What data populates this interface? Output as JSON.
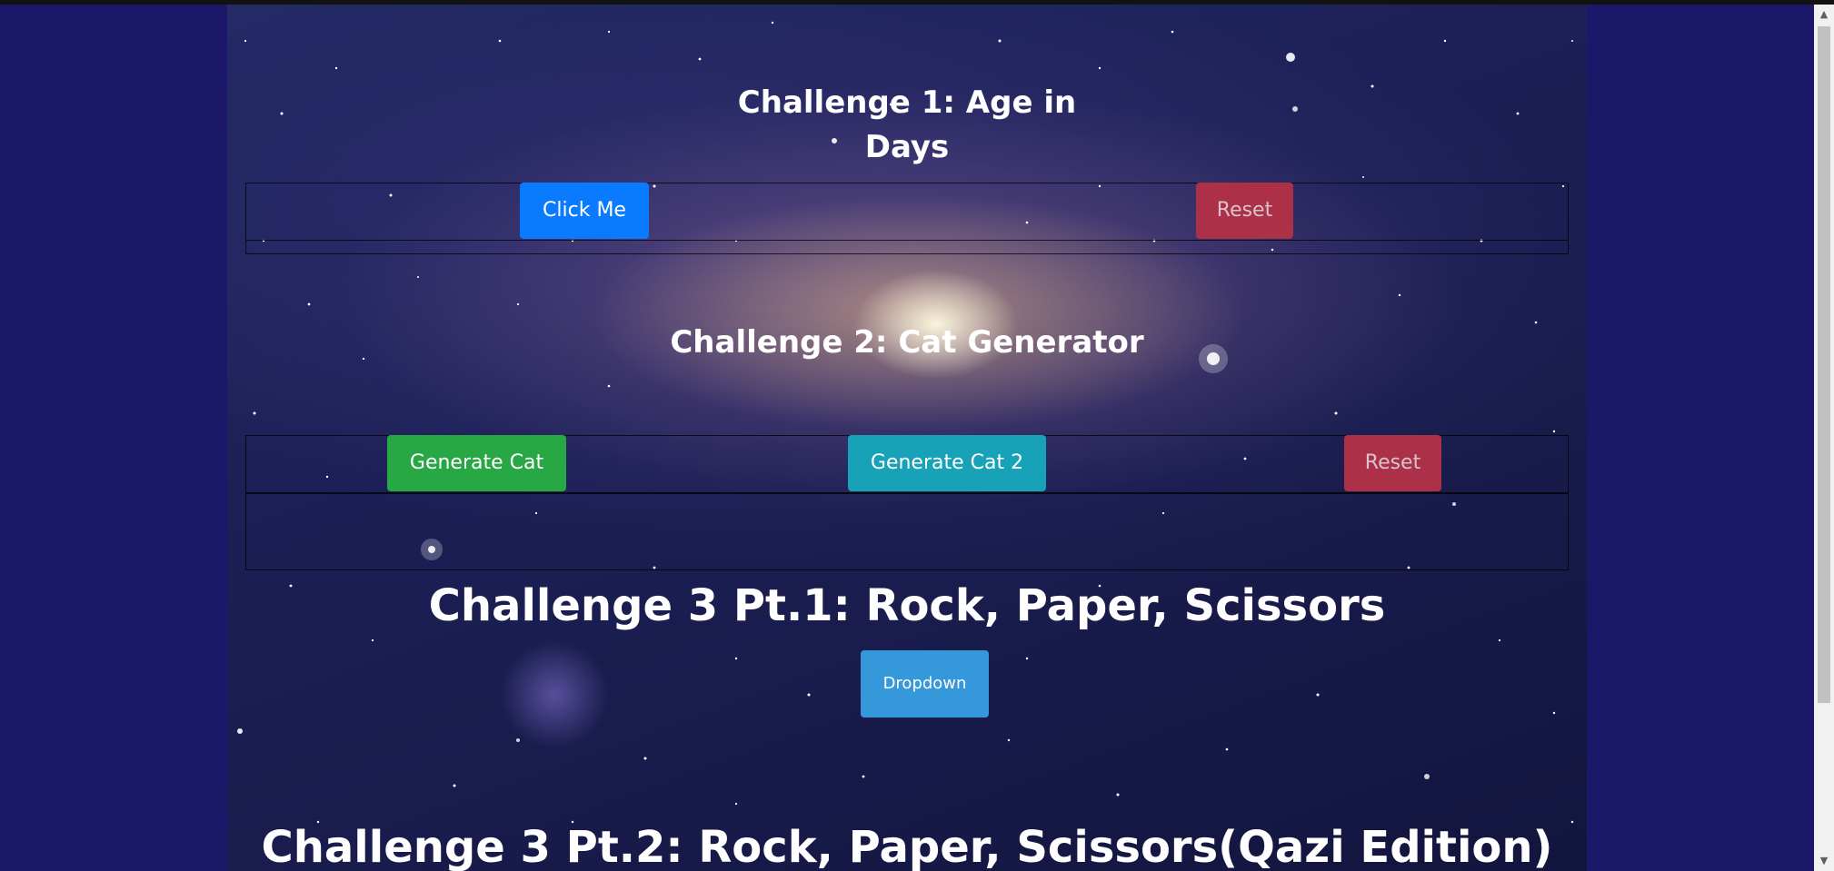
{
  "challenge1": {
    "title_line1": "Challenge 1: Age in",
    "title_line2": "Days",
    "click_me_label": "Click Me",
    "reset_label": "Reset"
  },
  "challenge2": {
    "title": "Challenge 2: Cat Generator",
    "generate_cat_label": "Generate Cat",
    "generate_cat_2_label": "Generate Cat 2",
    "reset_label": "Reset"
  },
  "challenge3_pt1": {
    "title": "Challenge 3 Pt.1: Rock, Paper, Scissors",
    "dropdown_label": "Dropdown"
  },
  "challenge3_pt2": {
    "title": "Challenge 3 Pt.2: Rock, Paper, Scissors(Qazi Edition)"
  },
  "theme": {
    "page_background": "#1b1769",
    "primary": "#0a7bff",
    "danger": "#ab3048",
    "success": "#28a745",
    "info": "#17a2b8",
    "dropdown": "#3498db"
  },
  "icons": {
    "scroll_up": "triangle-up-icon",
    "scroll_down": "triangle-down-icon"
  }
}
